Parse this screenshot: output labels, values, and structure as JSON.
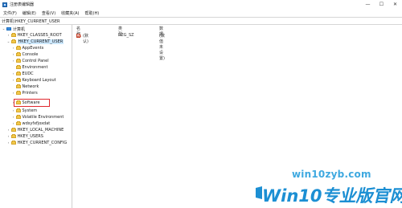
{
  "window": {
    "title": "注册表编辑器",
    "controls": {
      "minimize": "—",
      "maximize": "☐",
      "close": "✕"
    }
  },
  "menu": {
    "items": [
      "文件(F)",
      "编辑(E)",
      "查看(V)",
      "收藏夹(A)",
      "帮助(H)"
    ]
  },
  "address": {
    "path": "计算机\\HKEY_CURRENT_USER"
  },
  "tree": {
    "root": "计算机",
    "items": [
      {
        "label": "HKEY_CLASSES_ROOT",
        "level": 1,
        "expanded": false
      },
      {
        "label": "HKEY_CURRENT_USER",
        "level": 1,
        "expanded": true,
        "selected": true
      },
      {
        "label": "AppEvents",
        "level": 2,
        "expanded": false
      },
      {
        "label": "Console",
        "level": 2,
        "expanded": false
      },
      {
        "label": "Control Panel",
        "level": 2,
        "expanded": false
      },
      {
        "label": "Environment",
        "level": 2,
        "expanded": false
      },
      {
        "label": "EUDC",
        "level": 2,
        "expanded": false
      },
      {
        "label": "Keyboard Layout",
        "level": 2,
        "expanded": false
      },
      {
        "label": "Network",
        "level": 2,
        "expanded": false
      },
      {
        "label": "Printers",
        "level": 2,
        "expanded": false
      },
      {
        "label": "Software",
        "level": 2,
        "expanded": false,
        "highlighted": true
      },
      {
        "label": "System",
        "level": 2,
        "expanded": false
      },
      {
        "label": "Volatile Environment",
        "level": 2,
        "expanded": false
      },
      {
        "label": "wdsyfxfjoxdat",
        "level": 2,
        "expanded": false
      },
      {
        "label": "HKEY_LOCAL_MACHINE",
        "level": 1,
        "expanded": false
      },
      {
        "label": "HKEY_USERS",
        "level": 1,
        "expanded": false
      },
      {
        "label": "HKEY_CURRENT_CONFIG",
        "level": 1,
        "expanded": false
      }
    ]
  },
  "list": {
    "headers": {
      "name": "名称",
      "type": "类型",
      "data": "数据"
    },
    "rows": [
      {
        "name": "(默认)",
        "type": "REG_SZ",
        "data": "(数值未设置)"
      }
    ]
  },
  "watermark": {
    "small": "win10zyb.com",
    "big": "Win10专业版官网"
  },
  "colors": {
    "selection": "#cce8ff",
    "highlight_box": "#e0282e",
    "watermark": "#1c8fd3"
  }
}
